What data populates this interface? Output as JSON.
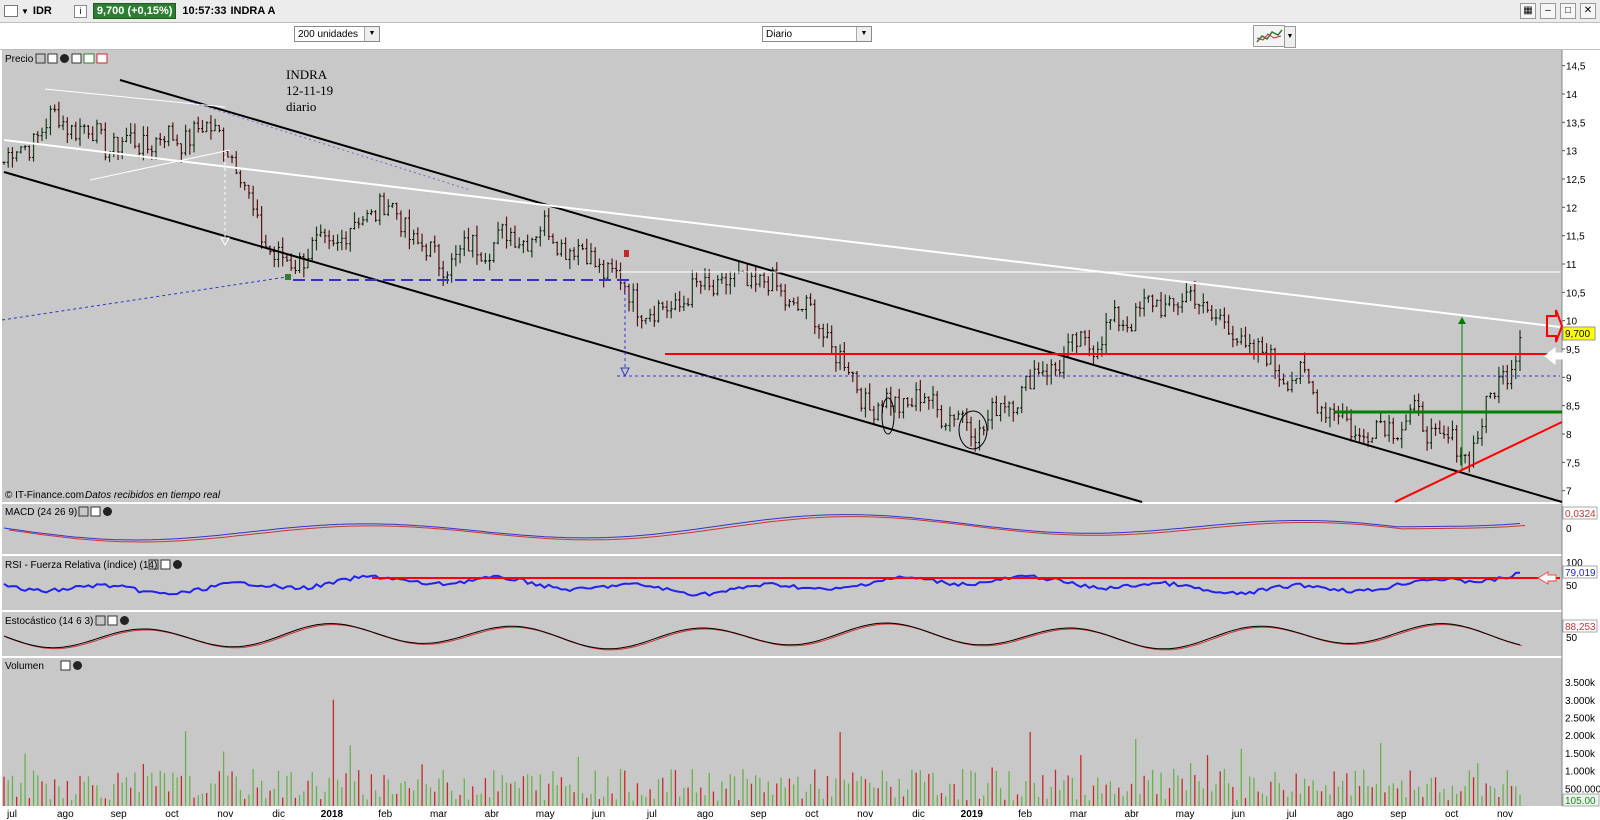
{
  "titlebar": {
    "symbol": "IDR",
    "info_icon": "i",
    "price_badge": "9,700 (+0,15%)",
    "time": "10:57:33",
    "instrument": "INDRA A"
  },
  "toolbar": {
    "bars_select": "200 unidades",
    "period_select": "Diario"
  },
  "annotation": {
    "line1": "INDRA",
    "line2": "12-11-19",
    "line3": "diario"
  },
  "panels": {
    "price": {
      "label": "Precio",
      "credit": "© IT-Finance.com",
      "credit_note": "Datos recibidos en tiempo real",
      "last_value": "9,700"
    },
    "macd": {
      "label": "MACD (24 26 9)",
      "last_value": "0,0324"
    },
    "rsi": {
      "label": "RSI - Fuerza Relativa (índice) (14)",
      "last_value": "79,019"
    },
    "stoch": {
      "label": "Estocástico (14 6 3)",
      "last_value": "88,253"
    },
    "volume": {
      "label": "Volumen",
      "last_value": "105.00"
    }
  },
  "price_axis": [
    "14,5",
    "14",
    "13,5",
    "13",
    "12,5",
    "12",
    "11,5",
    "11",
    "10,5",
    "10",
    "9,5",
    "9",
    "8,5",
    "8",
    "7,5",
    "7"
  ],
  "macd_axis": [
    "0"
  ],
  "rsi_axis": [
    "100",
    "50"
  ],
  "stoch_axis": [
    "50"
  ],
  "volume_axis": [
    "3.500k",
    "3.000k",
    "2.500k",
    "2.000k",
    "1.500k",
    "1.000k",
    "500.000"
  ],
  "x_axis": [
    "jul",
    "ago",
    "sep",
    "oct",
    "nov",
    "dic",
    "2018",
    "feb",
    "mar",
    "abr",
    "may",
    "jun",
    "jul",
    "ago",
    "sep",
    "oct",
    "nov",
    "dic",
    "2019",
    "feb",
    "mar",
    "abr",
    "may",
    "jun",
    "jul",
    "ago",
    "sep",
    "oct",
    "nov"
  ],
  "colors": {
    "bg_chart": "#c8c8c8",
    "up": "#2e7d32",
    "down": "#c62828",
    "resist": "#ff0000",
    "support": "#008000",
    "channel": "#000000",
    "trend": "#ffffff",
    "macd": "#3333cc",
    "signal": "#cc3333",
    "rsi": "#2222ee",
    "badge": "#ffff00"
  },
  "chart_data": {
    "type": "line",
    "title": "INDRA 12-11-19 diario",
    "x": [
      "jul",
      "ago",
      "sep",
      "oct",
      "nov",
      "dic",
      "2018",
      "feb",
      "mar",
      "abr",
      "may",
      "jun",
      "jul",
      "ago",
      "sep",
      "oct",
      "nov",
      "dic",
      "2019",
      "feb",
      "mar",
      "abr",
      "may",
      "jun",
      "jul",
      "ago",
      "sep",
      "oct",
      "nov"
    ],
    "series": [
      {
        "name": "Precio",
        "values": [
          12.8,
          13.6,
          13.1,
          13.2,
          13.4,
          11.0,
          11.3,
          12.1,
          11.0,
          11.4,
          11.6,
          11.0,
          10.1,
          10.6,
          10.7,
          10.0,
          8.5,
          8.6,
          8.1,
          9.0,
          9.6,
          10.2,
          10.4,
          9.5,
          8.9,
          8.0,
          8.3,
          7.6,
          9.7
        ]
      }
    ],
    "ylim": [
      6.8,
      14.6
    ],
    "last": 9.7
  }
}
